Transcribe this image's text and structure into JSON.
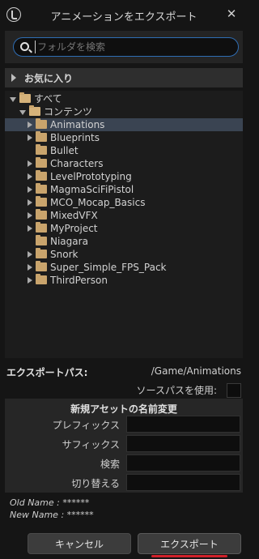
{
  "window": {
    "title": "アニメーションをエクスポート",
    "close_glyph": "✕"
  },
  "search": {
    "placeholder": "フォルダを検索",
    "value": ""
  },
  "favorites": {
    "label": "お気に入り"
  },
  "tree": {
    "root": "すべて",
    "content": "コンテンツ",
    "selected": "Animations",
    "folders": [
      {
        "name": "Animations",
        "expandable": true
      },
      {
        "name": "Blueprints",
        "expandable": true
      },
      {
        "name": "Bullet",
        "expandable": false
      },
      {
        "name": "Characters",
        "expandable": true
      },
      {
        "name": "LevelPrototyping",
        "expandable": true
      },
      {
        "name": "MagmaSciFiPistol",
        "expandable": true
      },
      {
        "name": "MCO_Mocap_Basics",
        "expandable": true
      },
      {
        "name": "MixedVFX",
        "expandable": true
      },
      {
        "name": "MyProject",
        "expandable": true
      },
      {
        "name": "Niagara",
        "expandable": false
      },
      {
        "name": "Snork",
        "expandable": true
      },
      {
        "name": "Super_Simple_FPS_Pack",
        "expandable": true
      },
      {
        "name": "ThirdPerson",
        "expandable": true
      }
    ]
  },
  "export_path": {
    "label": "エクスポートパス:",
    "value": "/Game/Animations"
  },
  "source_path": {
    "label": "ソースパスを使用:",
    "checked": false
  },
  "rename": {
    "title": "新規アセットの名前変更",
    "prefix_label": "プレフィックス",
    "suffix_label": "サフィックス",
    "search_label": "検索",
    "replace_label": "切り替える"
  },
  "info": {
    "old_name": "Old Name : ******",
    "new_name": "New Name : ******"
  },
  "buttons": {
    "cancel": "キャンセル",
    "export": "エクスポート"
  },
  "colors": {
    "accent": "#2f6db3",
    "selected_row": "#3a4452",
    "folder": "#c9a46c",
    "export_underline": "#d0202a"
  }
}
